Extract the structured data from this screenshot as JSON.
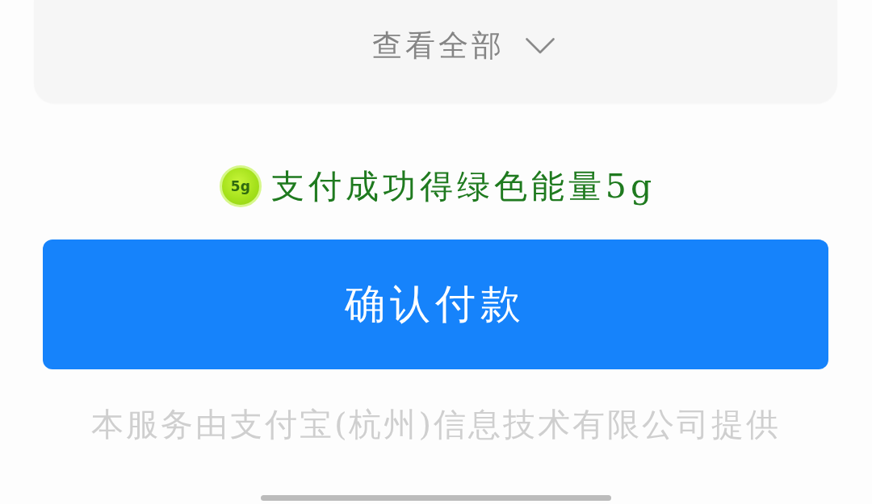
{
  "card": {
    "expand_link": "查看全部"
  },
  "energy_notice": {
    "badge": "5g",
    "text": "支付成功得绿色能量5g"
  },
  "confirm_button": {
    "label": "确认付款"
  },
  "footer": {
    "text": "本服务由支付宝(杭州)信息技术有限公司提供"
  }
}
